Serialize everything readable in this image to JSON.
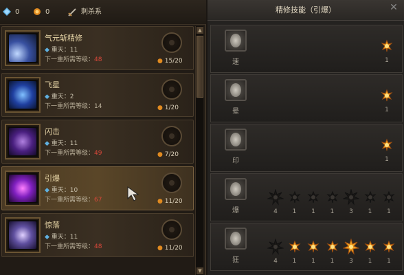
{
  "topbar": {
    "count_a": "0",
    "count_b": "0",
    "school": "刺杀系"
  },
  "skills": [
    {
      "name": "气元斩精修",
      "lv_label": "重天：11",
      "req_label": "下一重所需等级：",
      "req_value": "48",
      "progress": "15/20",
      "current": 15,
      "total": 20
    },
    {
      "name": "飞星",
      "lv_label": "重天：2",
      "req_label": "下一重所需等级：",
      "req_value": "14",
      "progress": "1/20",
      "current": 1,
      "total": 20
    },
    {
      "name": "闪击",
      "lv_label": "重天：11",
      "req_label": "下一重所需等级：",
      "req_value": "49",
      "progress": "7/20",
      "current": 7,
      "total": 20
    },
    {
      "name": "引爆",
      "lv_label": "重天：10",
      "req_label": "下一重所需等级：",
      "req_value": "67",
      "progress": "11/20",
      "current": 11,
      "total": 20
    },
    {
      "name": "惊落",
      "lv_label": "重天：11",
      "req_label": "下一重所需等级：",
      "req_value": "48",
      "progress": "11/20",
      "current": 11,
      "total": 20
    }
  ],
  "panel": {
    "title": "精修技能（引爆）",
    "rows": [
      {
        "label": "速",
        "nodes": [
          {
            "count": "1",
            "lit": true
          }
        ]
      },
      {
        "label": "晕",
        "nodes": [
          {
            "count": "1",
            "lit": true
          }
        ]
      },
      {
        "label": "印",
        "nodes": [
          {
            "count": "1",
            "lit": true
          }
        ]
      },
      {
        "label": "爆",
        "nodes": [
          {
            "count": "4",
            "lit": false,
            "big": true
          },
          {
            "count": "1",
            "lit": false
          },
          {
            "count": "1",
            "lit": false
          },
          {
            "count": "1",
            "lit": false
          },
          {
            "count": "3",
            "lit": false,
            "big": true
          },
          {
            "count": "1",
            "lit": false
          },
          {
            "count": "1",
            "lit": false
          }
        ]
      },
      {
        "label": "狂",
        "nodes": [
          {
            "count": "4",
            "lit": false,
            "big": true
          },
          {
            "count": "1",
            "lit": true
          },
          {
            "count": "1",
            "lit": true
          },
          {
            "count": "1",
            "lit": true
          },
          {
            "count": "3",
            "lit": true,
            "big": true
          },
          {
            "count": "1",
            "lit": true
          },
          {
            "count": "1",
            "lit": true
          }
        ]
      }
    ]
  },
  "colors": {
    "accent": "#d9473a",
    "gold": "#e6d4a6",
    "lit_star": "#f0a020"
  }
}
